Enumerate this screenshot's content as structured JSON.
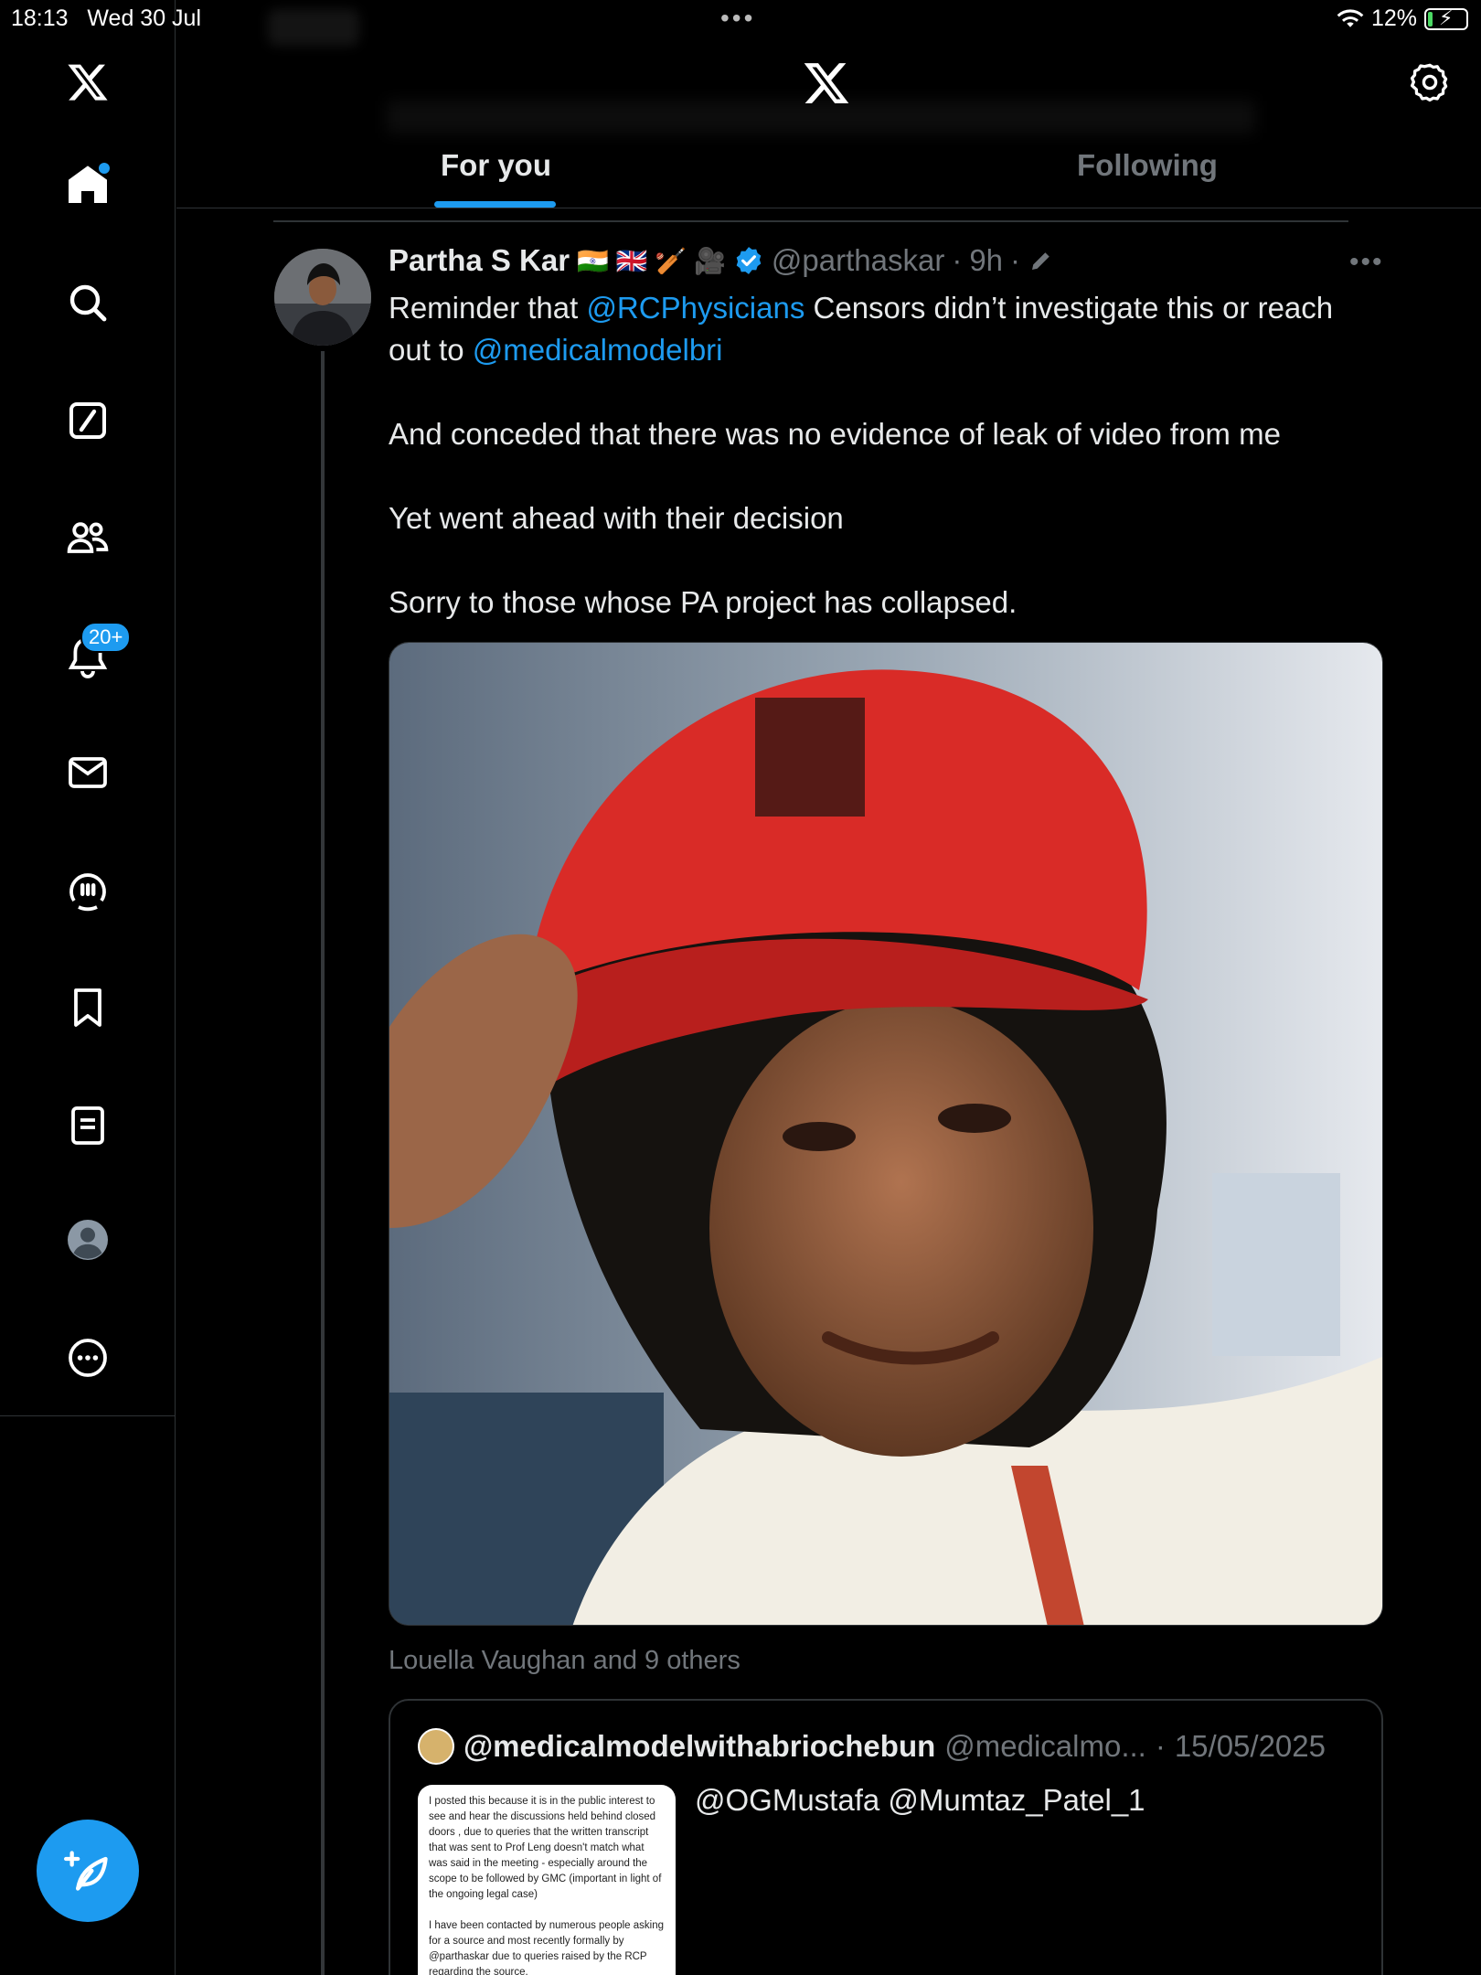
{
  "status_bar": {
    "time": "18:13",
    "date": "Wed 30 Jul",
    "battery": "12%",
    "battery_level": 0.12
  },
  "sidebar": {
    "items": [
      {
        "name": "home",
        "icon": "home-icon",
        "active": true
      },
      {
        "name": "explore",
        "icon": "search-icon"
      },
      {
        "name": "grok",
        "icon": "grok-icon"
      },
      {
        "name": "communities",
        "icon": "communities-icon"
      },
      {
        "name": "notifications",
        "icon": "bell-icon",
        "badge": "20+"
      },
      {
        "name": "messages",
        "icon": "mail-icon"
      },
      {
        "name": "spaces",
        "icon": "spaces-icon"
      },
      {
        "name": "bookmarks",
        "icon": "bookmark-icon"
      },
      {
        "name": "lists",
        "icon": "list-icon"
      },
      {
        "name": "profile",
        "icon": "profile-icon"
      },
      {
        "name": "more",
        "icon": "more-circle-icon"
      }
    ],
    "compose_icon": "compose-icon"
  },
  "header": {
    "tabs": [
      {
        "label": "For you",
        "active": true
      },
      {
        "label": "Following",
        "active": false
      }
    ]
  },
  "tweet": {
    "author_name": "Partha S Kar",
    "emojis": "🇮🇳 🇬🇧 🏏 🎥",
    "handle": "@parthaskar",
    "time": "9h",
    "text": {
      "l1_pre": "Reminder that ",
      "l1_mention": "@RCPhysicians",
      "l1_post": " Censors didn’t investigate this or reach out to ",
      "l1_mention2": "@medicalmodelbri",
      "p2": "And conceded that there was no evidence of leak of video from me",
      "p3": "Yet went ahead with their decision",
      "p4": "Sorry to those whose PA project has collapsed."
    },
    "liked_by": "Louella Vaughan and 9 others"
  },
  "quote": {
    "author_name": "@medicalmodelwithabriochebun",
    "handle": "@medicalmo...",
    "date": "15/05/2025",
    "body": "@OGMustafa @Mumtaz_Patel_1",
    "thumb_p1": "I posted this because it is in the public interest to see and hear the discussions held behind closed doors , due to queries that the written transcript that was sent to Prof Leng doesn't match what was said in the meeting - especially around the scope to be followed by GMC (important in light of the ongoing legal case)",
    "thumb_p2": "I have been contacted by numerous people asking for a source and most recently formally by @parthaskar due to queries raised by the RCP regarding the source."
  },
  "colors": {
    "accent": "#1d9bf0",
    "background": "#000000",
    "text": "#e7e9ea",
    "muted": "#71767b",
    "border": "#2f3336"
  }
}
